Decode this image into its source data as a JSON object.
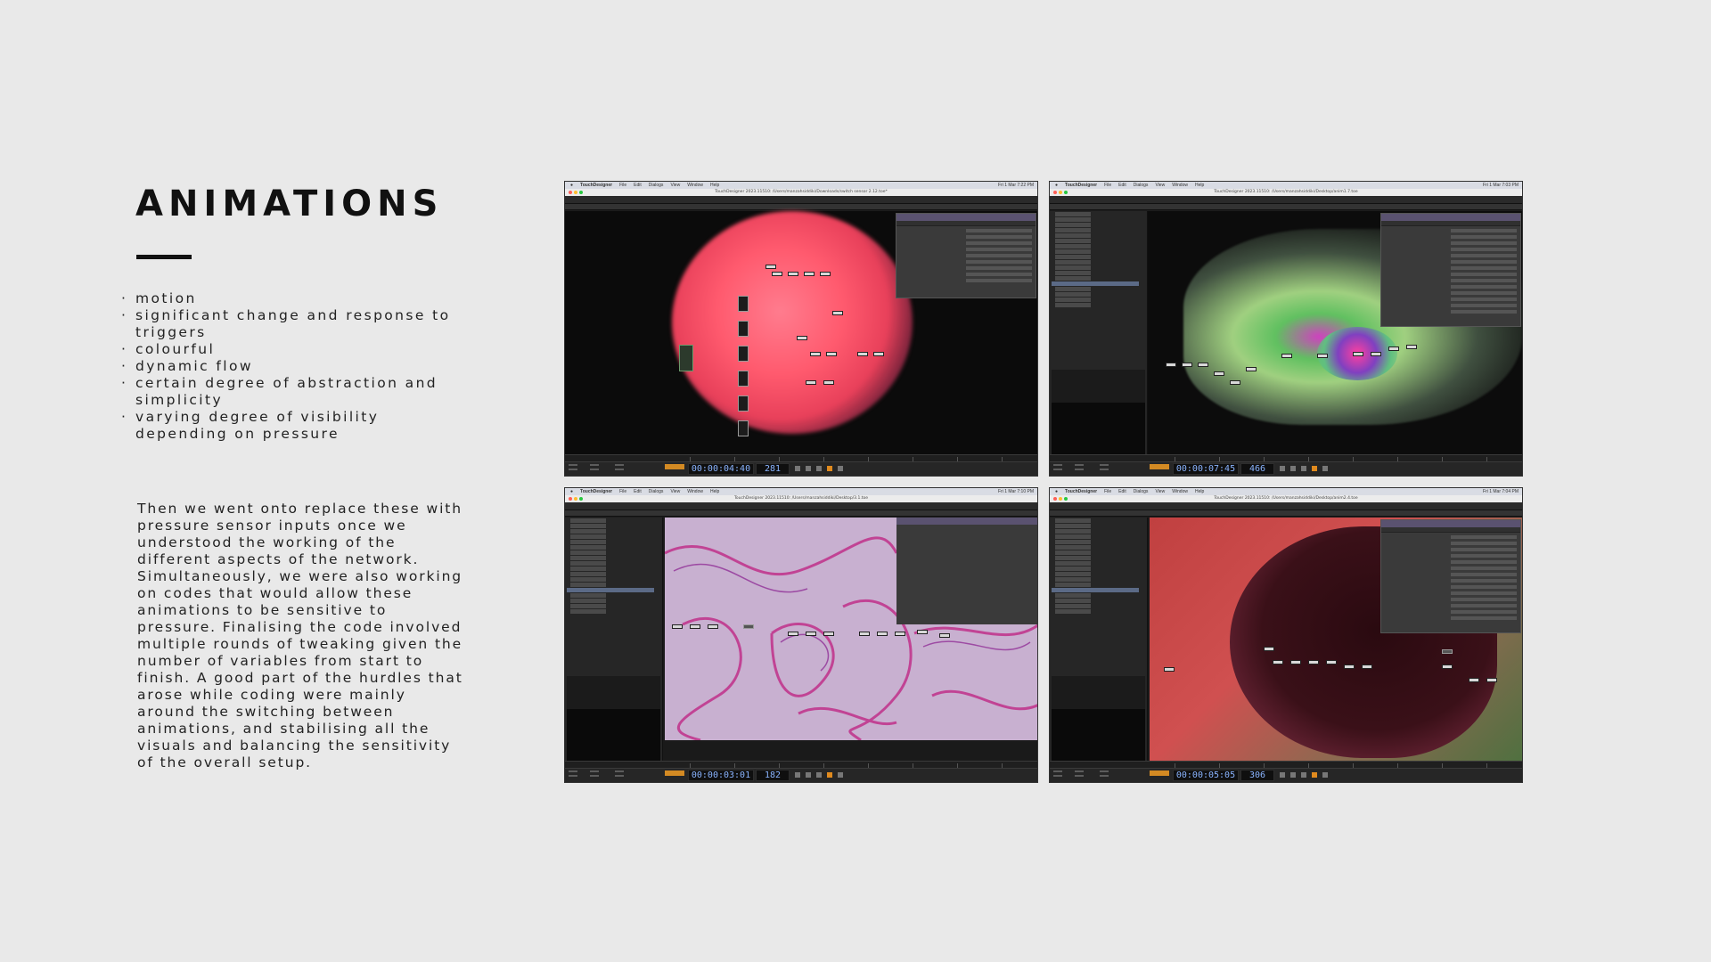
{
  "slide": {
    "title": "ANIMATIONS",
    "bullets": [
      "motion",
      "significant change and response to triggers",
      "colourful",
      "dynamic flow",
      "certain degree of abstraction and simplicity",
      "varying degree of visibility depending on pressure"
    ],
    "paragraph": "Then we went onto replace these with pressure sensor inputs once we understood the working of the different aspects of the network. Simultaneously, we were also working on codes that would allow these animations to be sensitive to pressure. Finalising the code involved multiple rounds of tweaking given the number of variables from start to finish. A good part of the hurdles that arose while coding were mainly around the switching between animations, and stabilising all the visuals and balancing the sensitivity of the overall setup."
  },
  "screenshots": [
    {
      "app": "TouchDesigner",
      "menu": [
        "File",
        "Edit",
        "Dialogs",
        "View",
        "Window",
        "Help"
      ],
      "window_title": "TouchDesigner 2023.11510: /Users/manzahsiddiki/Downloads/switch sensor 2.12.toe*",
      "timecode": "00:00:04:40",
      "frame": "281",
      "clock": "Fri 1 Mar 7:22 PM",
      "accent": "#ff5a6e"
    },
    {
      "app": "TouchDesigner",
      "menu": [
        "File",
        "Edit",
        "Dialogs",
        "View",
        "Window",
        "Help"
      ],
      "window_title": "TouchDesigner 2023.11510: /Users/manzahsiddiki/Desktop/anim1.7.toe",
      "timecode": "00:00:07:45",
      "frame": "466",
      "clock": "Fri 1 Mar 7:03 PM",
      "accent": "#a8e060"
    },
    {
      "app": "TouchDesigner",
      "menu": [
        "File",
        "Edit",
        "Dialogs",
        "View",
        "Window",
        "Help"
      ],
      "window_title": "TouchDesigner 2023.11510: /Users/manzahsiddiki/Desktop/3.1.toe",
      "timecode": "00:00:03:01",
      "frame": "182",
      "clock": "Fri 1 Mar 7:10 PM",
      "accent": "#c050a0"
    },
    {
      "app": "TouchDesigner",
      "menu": [
        "File",
        "Edit",
        "Dialogs",
        "View",
        "Window",
        "Help"
      ],
      "window_title": "TouchDesigner 2023.11510: /Users/manzahsiddiki/Desktop/anim2.4.toe",
      "timecode": "00:00:05:05",
      "frame": "306",
      "clock": "Fri 1 Mar 7:04 PM",
      "accent": "#d06060"
    }
  ]
}
